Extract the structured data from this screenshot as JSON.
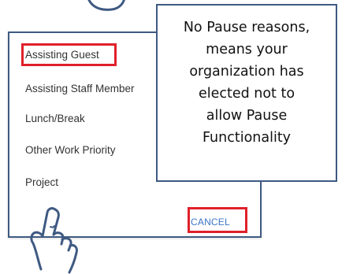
{
  "dialog": {
    "options": [
      "Assisting Guest",
      "Assisting Staff Member",
      "Lunch/Break",
      "Other Work Priority",
      "Project"
    ],
    "cancel_label": "CANCEL"
  },
  "callout": {
    "text": "No Pause reasons,\nmeans your\norganization has\nelected not to\nallow Pause\nFunctionality"
  },
  "colors": {
    "highlight": "#e0202a",
    "border": "#3f5a82",
    "link": "#3b74c6"
  },
  "icons": [
    "pointing-hand-icon",
    "hand-outline-icon"
  ]
}
